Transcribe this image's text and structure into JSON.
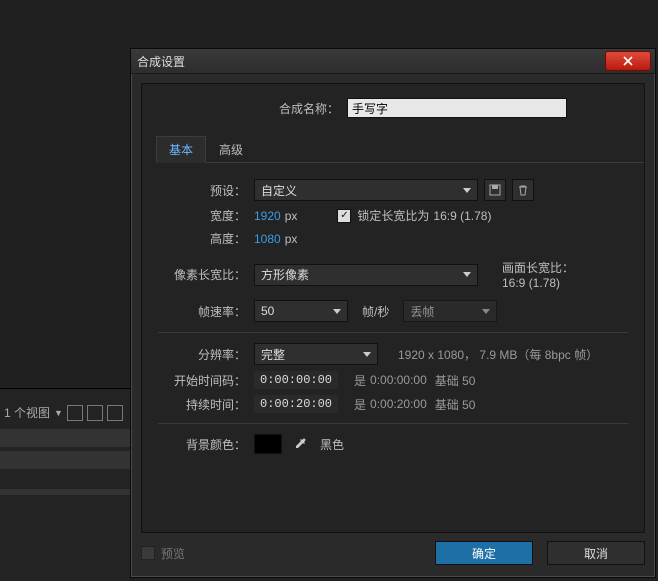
{
  "bgPanel": {
    "viewLabel": "1 个视图"
  },
  "dialog": {
    "title": "合成设置",
    "compNameLabel": "合成名称：",
    "compName": "手写字",
    "tabs": {
      "basic": "基本",
      "advanced": "高级"
    },
    "preset": {
      "label": "预设：",
      "value": "自定义"
    },
    "width": {
      "label": "宽度：",
      "value": "1920",
      "unit": "px"
    },
    "height": {
      "label": "高度：",
      "value": "1080",
      "unit": "px"
    },
    "lockAspect": {
      "label": "锁定长宽比为",
      "ratio": "16:9 (1.78)"
    },
    "pixelAspect": {
      "label": "像素长宽比：",
      "value": "方形像素"
    },
    "frameAspect": {
      "label": "画面长宽比：",
      "value": "16:9 (1.78)"
    },
    "frameRate": {
      "label": "帧速率：",
      "value": "50",
      "unitLabel": "帧/秒",
      "dropValue": "丢帧"
    },
    "resolution": {
      "label": "分辨率：",
      "value": "完整",
      "info": "1920 x 1080， 7.9 MB（每 8bpc 帧）"
    },
    "startTime": {
      "label": "开始时间码：",
      "value": "0:00:00:00",
      "is": "是",
      "ref": "0:00:00:00",
      "base": "基础 50"
    },
    "duration": {
      "label": "持续时间：",
      "value": "0:00:20:00",
      "is": "是",
      "ref": "0:00:20:00",
      "base": "基础 50"
    },
    "bgColor": {
      "label": "背景颜色：",
      "name": "黑色"
    },
    "footer": {
      "preview": "预览",
      "ok": "确定",
      "cancel": "取消"
    }
  }
}
